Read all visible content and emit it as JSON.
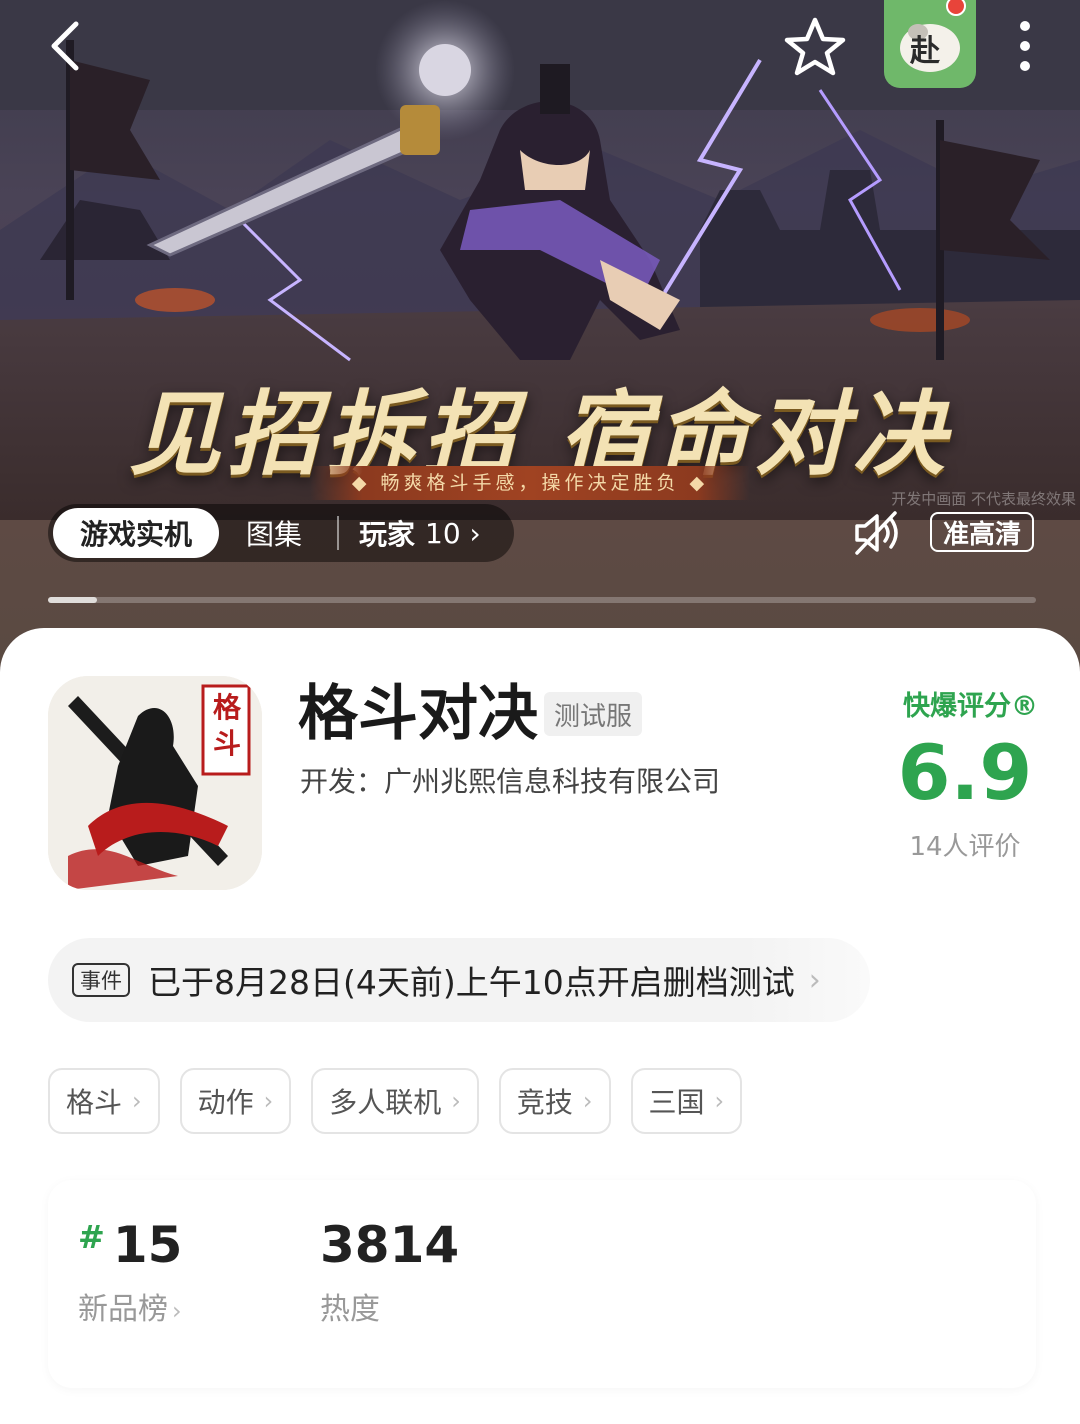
{
  "hero": {
    "title": "见招拆招  宿命对决",
    "subtitle": "◆ 畅爽格斗手感，操作决定胜负 ◆",
    "disclaimer": "开发中画面 不代表最终效果"
  },
  "topbar": {
    "back_icon": "back-chevron-icon",
    "favorite_icon": "star-outline-icon",
    "avatar_text": "赴",
    "more_icon": "more-vertical-icon"
  },
  "media": {
    "tabs": [
      {
        "label": "游戏实机",
        "active": true
      },
      {
        "label": "图集",
        "active": false
      }
    ],
    "players_label": "玩家",
    "players_count": "10 ›",
    "quality_label": "准高清",
    "progress": 0.05
  },
  "game": {
    "title": "格斗对决",
    "server_badge": "测试服",
    "developer": "开发：广州兆熙信息科技有限公司",
    "icon_text": "格斗"
  },
  "rating": {
    "label": "快爆评分®",
    "score": "6.9",
    "count": "14人评价",
    "color": "#2ea44f"
  },
  "event": {
    "tag": "事件",
    "text": "已于8月28日(4天前)上午10点开启删档测试",
    "chevron": "›"
  },
  "tags": [
    {
      "label": "格斗"
    },
    {
      "label": "动作"
    },
    {
      "label": "多人联机"
    },
    {
      "label": "竞技"
    },
    {
      "label": "三国"
    }
  ],
  "stats": {
    "rank_hash": "#",
    "rank_value": "15",
    "rank_label": "新品榜",
    "hot_value": "3814",
    "hot_label": "热度"
  }
}
